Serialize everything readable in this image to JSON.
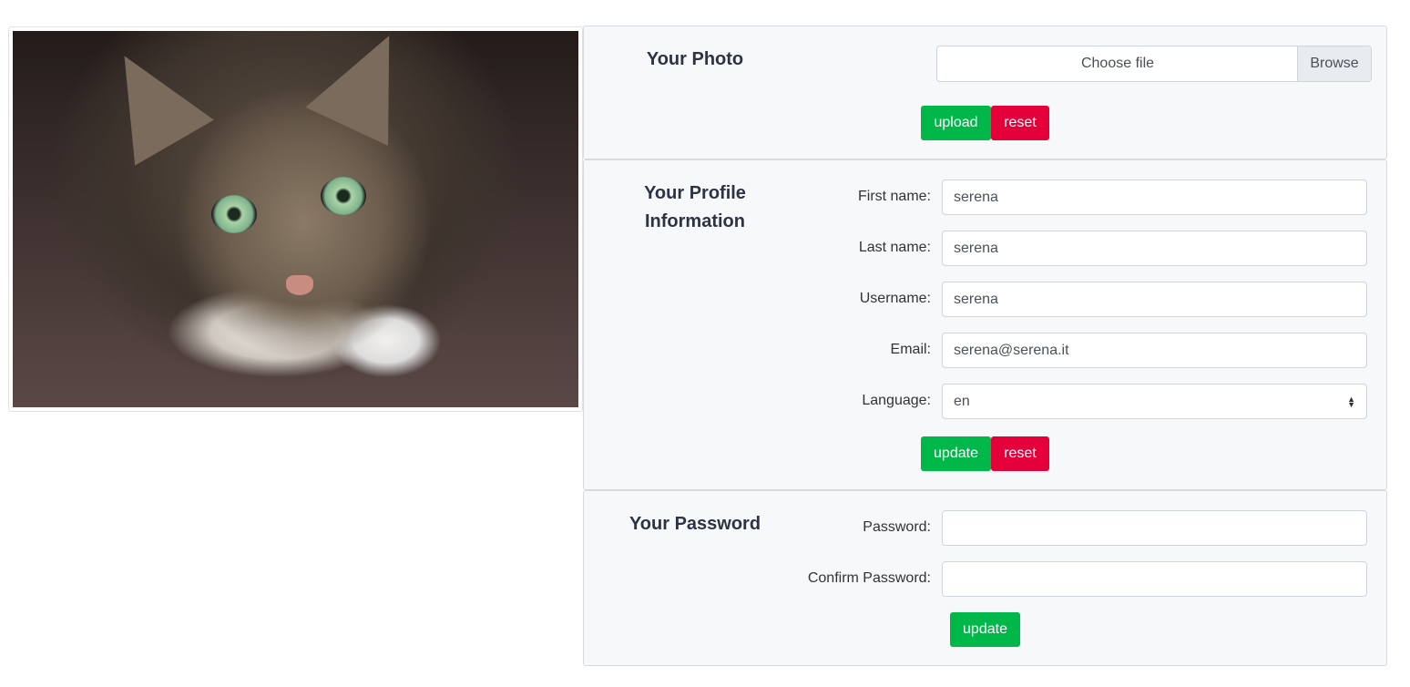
{
  "photo_panel": {
    "title": "Your Photo",
    "file_placeholder": "Choose file",
    "browse_label": "Browse",
    "upload_label": "upload",
    "reset_label": "reset"
  },
  "profile_panel": {
    "title_line1": "Your Profile",
    "title_line2": "Information",
    "fields": [
      {
        "label": "First name:",
        "value": "serena"
      },
      {
        "label": "Last name:",
        "value": "serena"
      },
      {
        "label": "Username:",
        "value": "serena"
      },
      {
        "label": "Email:",
        "value": "serena@serena.it"
      },
      {
        "label": "Language:",
        "value": "en"
      }
    ],
    "update_label": "update",
    "reset_label": "reset"
  },
  "password_panel": {
    "title": "Your Password",
    "password_label": "Password:",
    "password_value": "",
    "confirm_label": "Confirm Password:",
    "confirm_value": "",
    "update_label": "update"
  },
  "colors": {
    "success": "#00b84a",
    "danger": "#e4003a"
  }
}
